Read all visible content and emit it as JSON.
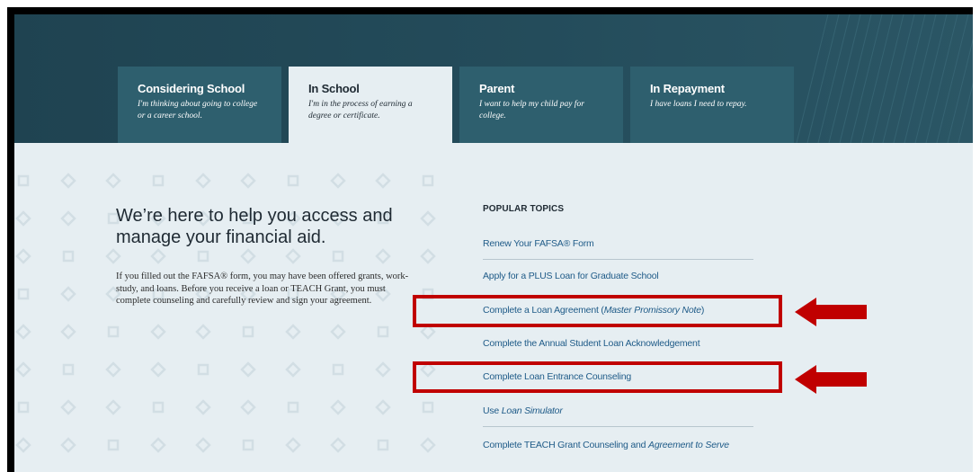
{
  "tabs": [
    {
      "title": "Considering School",
      "desc": "I'm thinking about going to college or a career school."
    },
    {
      "title": "In School",
      "desc": "I'm in the process of earning a degree or certificate."
    },
    {
      "title": "Parent",
      "desc": "I want to help my child pay for college."
    },
    {
      "title": "In Repayment",
      "desc": "I have loans I need to repay."
    }
  ],
  "main": {
    "headline": "We’re here to help you access and manage your financial aid.",
    "intro": "If you filled out the FAFSA® form, you may have been offered grants, work-study, and loans. Before you receive a loan or TEACH Grant, you must complete counseling and carefully review and sign your agreement."
  },
  "popular_topics": {
    "heading": "POPULAR TOPICS",
    "items": [
      {
        "text": "Renew Your FAFSA® Form"
      },
      {
        "text": "Apply for a PLUS Loan for Graduate School"
      },
      {
        "text": "Complete a Loan Agreement (",
        "italic": "Master Promissory Note",
        "after": ")"
      },
      {
        "text": "Complete the Annual Student Loan Acknowledgement"
      },
      {
        "text": "Complete Loan Entrance Counseling"
      },
      {
        "text": "Use ",
        "italic": "Loan Simulator",
        "after": ""
      },
      {
        "text": "Complete TEACH Grant Counseling and ",
        "italic": "Agreement to Serve",
        "after": ""
      }
    ]
  },
  "annotations": {
    "color": "#c00000",
    "highlighted_items": [
      "Complete a Loan Agreement (Master Promissory Note)",
      "Complete Loan Entrance Counseling"
    ]
  },
  "icons": [
    "diamond-outline-icon",
    "square-outline-icon",
    "arrow-left-icon"
  ]
}
